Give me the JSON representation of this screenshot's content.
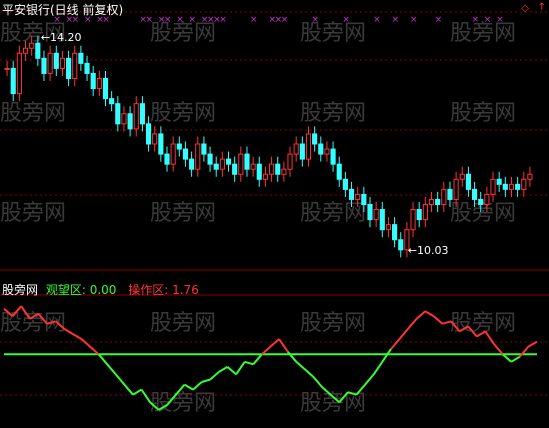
{
  "main": {
    "title": "平安银行(日线 前复权)",
    "high_annot": "14.20",
    "low_annot": "10.03",
    "watermark": "股旁网"
  },
  "indicator": {
    "name": "股旁网",
    "label_a": "观望区: 0.00",
    "label_b": "操作区: 1.76"
  },
  "colors": {
    "up": "#ff3333",
    "down": "#33ffff",
    "grid": "#8b0000",
    "line_a": "#33ff33",
    "line_b": "#ff3333",
    "marker": "#cc33cc",
    "bg": "#000000"
  },
  "icons": {
    "corner_left": "diamond-icon",
    "corner_right": "arrow-icon"
  },
  "chart_data": {
    "type": "candlestick",
    "y_range": [
      9.6,
      14.6
    ],
    "closes": [
      13.6,
      13.1,
      13.9,
      14.0,
      14.1,
      13.8,
      13.5,
      13.9,
      13.6,
      13.8,
      13.4,
      13.9,
      13.7,
      13.5,
      13.2,
      13.4,
      13.0,
      12.9,
      12.5,
      12.7,
      12.4,
      12.9,
      12.5,
      12.1,
      12.3,
      11.9,
      11.7,
      12.1,
      12.0,
      11.8,
      11.6,
      12.1,
      11.9,
      11.7,
      11.6,
      11.8,
      11.7,
      11.5,
      11.9,
      11.6,
      11.7,
      11.4,
      11.5,
      11.7,
      11.5,
      11.6,
      11.9,
      12.1,
      11.8,
      12.3,
      12.1,
      11.9,
      12.0,
      11.7,
      11.4,
      11.2,
      11.0,
      11.1,
      10.9,
      10.6,
      10.8,
      10.4,
      10.5,
      10.2,
      10.0,
      10.4,
      10.8,
      10.6,
      10.9,
      11.0,
      10.9,
      11.2,
      11.0,
      11.4,
      11.5,
      11.2,
      11.0,
      10.9,
      11.1,
      11.4,
      11.3,
      11.2,
      11.3,
      11.2,
      11.4,
      11.5
    ],
    "indicator_a": [
      1.8,
      1.5,
      1.9,
      1.4,
      1.6,
      1.2,
      1.3,
      1.0,
      0.8,
      0.6,
      0.3,
      0.0,
      -0.4,
      -0.8,
      -1.2,
      -1.6,
      -1.4,
      -1.9,
      -2.2,
      -2.0,
      -1.6,
      -1.2,
      -1.4,
      -1.1,
      -1.0,
      -0.7,
      -0.5,
      -0.8,
      -0.3,
      -0.4,
      0.0,
      0.3,
      0.6,
      0.1,
      -0.3,
      -0.6,
      -0.9,
      -1.3,
      -1.6,
      -1.9,
      -1.5,
      -1.6,
      -1.2,
      -0.8,
      -0.3,
      0.2,
      0.6,
      1.0,
      1.4,
      1.7,
      1.5,
      1.2,
      1.3,
      0.9,
      1.1,
      0.7,
      0.9,
      0.4,
      0.0,
      -0.3,
      -0.1,
      0.3,
      0.5
    ],
    "indicator_b": 0.0,
    "indicator_range": [
      -2.6,
      2.3
    ],
    "markers": [
      8,
      10,
      11,
      13,
      15,
      16,
      22,
      23,
      25,
      26,
      28,
      30,
      32,
      33,
      34,
      35,
      40,
      43,
      44,
      45,
      50,
      55,
      60,
      63,
      66,
      70,
      76,
      78,
      80
    ]
  }
}
